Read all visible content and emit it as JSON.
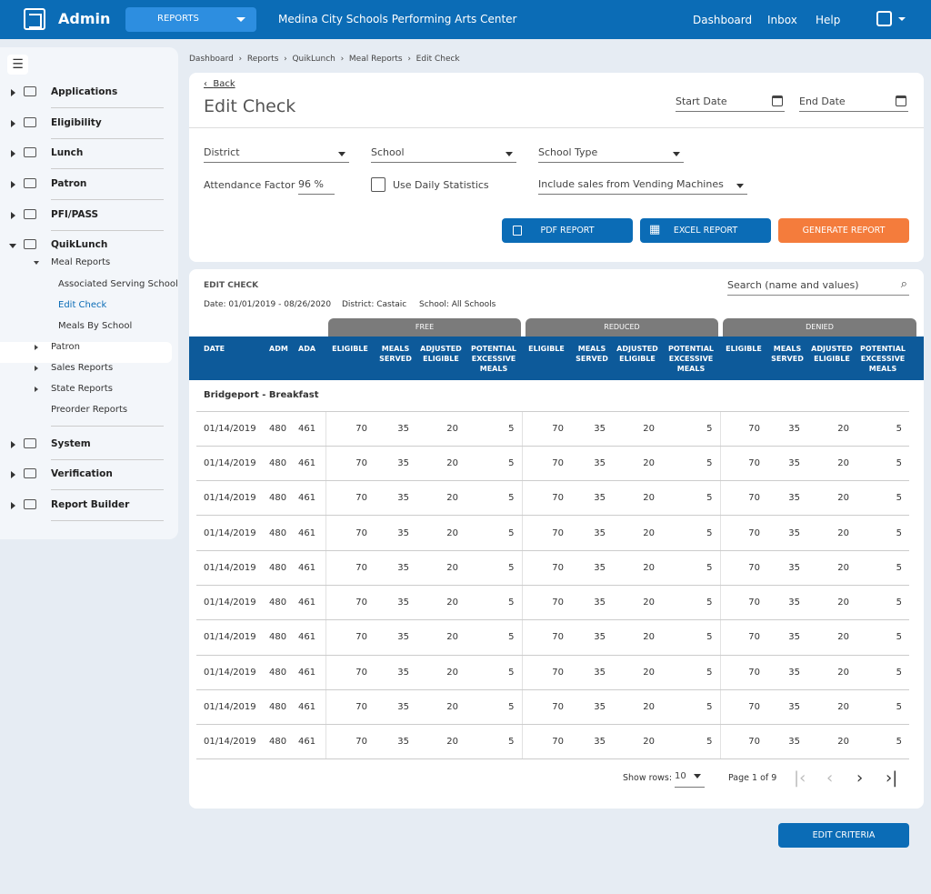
{
  "topbar": {
    "app": "Admin",
    "module": "REPORTS",
    "org": "Medina City Schools Performing Arts Center",
    "nav": [
      "Dashboard",
      "Inbox",
      "Help"
    ]
  },
  "sidebar": {
    "items": [
      "Applications",
      "Eligibility",
      "Lunch",
      "Patron",
      "PFI/PASS",
      "QuikLunch",
      "System",
      "Verification",
      "Report Builder"
    ],
    "quiklunch": {
      "meal_reports": "Meal Reports",
      "meal_children": [
        "Associated Serving School",
        "Edit Check",
        "Meals By School"
      ],
      "others": [
        "Patron",
        "Sales Reports",
        "State Reports",
        "Preorder Reports"
      ]
    },
    "active": "Edit Check",
    "accent": "#0b6cb6"
  },
  "breadcrumb": [
    "Dashboard",
    "Reports",
    "QuikLunch",
    "Meal Reports",
    "Edit Check"
  ],
  "criteria": {
    "back": "Back",
    "title": "Edit Check",
    "start_date": "Start Date",
    "end_date": "End Date",
    "district": "District",
    "school": "School",
    "school_type": "School Type",
    "attendance_label": "Attendance Factor",
    "attendance_value": "96 %",
    "use_daily": "Use Daily Statistics",
    "use_daily_checked": false,
    "vending": "Include sales from Vending Machines",
    "pdf": "PDF REPORT",
    "excel": "EXCEL REPORT",
    "generate": "GENERATE REPORT",
    "generate_color": "#f47c3c"
  },
  "report": {
    "title": "EDIT CHECK",
    "date": "Date: 01/01/2019 - 08/26/2020",
    "district": "District: Castaic",
    "school": "School: All Schools",
    "search_placeholder": "Search (name and values)",
    "groups": [
      "FREE",
      "REDUCED",
      "DENIED"
    ],
    "columns": [
      "DATE",
      "ADM",
      "ADA",
      "ELIGIBLE",
      "MEALS SERVED",
      "ADJUSTED ELIGIBLE",
      "POTENTIAL EXCESSIVE MEALS",
      "ELIGIBLE",
      "MEALS SERVED",
      "ADJUSTED ELIGIBLE",
      "POTENTIAL EXCESSIVE MEALS",
      "ELIGIBLE",
      "MEALS SERVED",
      "ADJUSTED ELIGIBLE",
      "POTENTIAL EXCESSIVE MEALS"
    ],
    "group_label": "Bridgeport - Breakfast",
    "rows": [
      [
        "01/14/2019",
        "480",
        "461",
        "70",
        "35",
        "20",
        "5",
        "70",
        "35",
        "20",
        "5",
        "70",
        "35",
        "20",
        "5"
      ],
      [
        "01/14/2019",
        "480",
        "461",
        "70",
        "35",
        "20",
        "5",
        "70",
        "35",
        "20",
        "5",
        "70",
        "35",
        "20",
        "5"
      ],
      [
        "01/14/2019",
        "480",
        "461",
        "70",
        "35",
        "20",
        "5",
        "70",
        "35",
        "20",
        "5",
        "70",
        "35",
        "20",
        "5"
      ],
      [
        "01/14/2019",
        "480",
        "461",
        "70",
        "35",
        "20",
        "5",
        "70",
        "35",
        "20",
        "5",
        "70",
        "35",
        "20",
        "5"
      ],
      [
        "01/14/2019",
        "480",
        "461",
        "70",
        "35",
        "20",
        "5",
        "70",
        "35",
        "20",
        "5",
        "70",
        "35",
        "20",
        "5"
      ],
      [
        "01/14/2019",
        "480",
        "461",
        "70",
        "35",
        "20",
        "5",
        "70",
        "35",
        "20",
        "5",
        "70",
        "35",
        "20",
        "5"
      ],
      [
        "01/14/2019",
        "480",
        "461",
        "70",
        "35",
        "20",
        "5",
        "70",
        "35",
        "20",
        "5",
        "70",
        "35",
        "20",
        "5"
      ],
      [
        "01/14/2019",
        "480",
        "461",
        "70",
        "35",
        "20",
        "5",
        "70",
        "35",
        "20",
        "5",
        "70",
        "35",
        "20",
        "5"
      ],
      [
        "01/14/2019",
        "480",
        "461",
        "70",
        "35",
        "20",
        "5",
        "70",
        "35",
        "20",
        "5",
        "70",
        "35",
        "20",
        "5"
      ],
      [
        "01/14/2019",
        "480",
        "461",
        "70",
        "35",
        "20",
        "5",
        "70",
        "35",
        "20",
        "5",
        "70",
        "35",
        "20",
        "5"
      ]
    ],
    "show_rows_label": "Show rows:",
    "show_rows_value": "10",
    "page": "Page 1 of 9"
  },
  "edit_criteria": "EDIT CRITERIA"
}
